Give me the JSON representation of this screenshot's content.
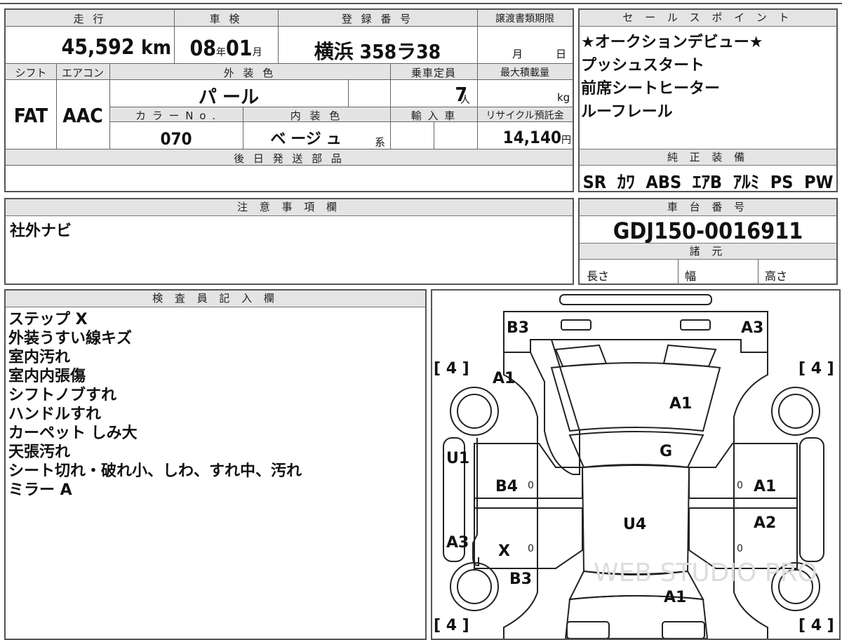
{
  "top_table": {
    "mileage_label": "走 行",
    "mileage_value": "45,592",
    "mileage_unit": "km",
    "inspection_label": "車 検",
    "inspection_year": "08",
    "inspection_year_unit": "年",
    "inspection_month": "01",
    "inspection_month_unit": "月",
    "registration_label": "登 録 番 号",
    "registration_value": "横浜 358ラ38",
    "transfer_deadline_label": "譲渡書類期限",
    "transfer_month_unit": "月",
    "transfer_day_unit": "日",
    "shift_label": "シフト",
    "shift_value": "FAT",
    "aircon_label": "エアコン",
    "aircon_value": "AAC",
    "exterior_color_label": "外 装 色",
    "exterior_color_value": "パ ール",
    "capacity_label": "乗車定員",
    "capacity_value": "7",
    "capacity_unit": "人",
    "max_load_label": "最大積載量",
    "max_load_unit": "kg",
    "color_no_label": "カ ラ ー  N o .",
    "color_no_value": "070",
    "interior_color_label": "内 装 色",
    "interior_color_value": "ベ ージ ュ",
    "interior_color_suffix": "系",
    "import_label": "輸 入 車",
    "recycle_label": "リサイクル預託金",
    "recycle_value": "14,140",
    "recycle_unit": "円",
    "later_parts_label": "後 日 発 送 部 品"
  },
  "sales_points": {
    "title": "セ ー ル ス ポ イ ン ト",
    "items": [
      "★オークションデビュー★",
      "プッシュスタート",
      "前席シートヒーター",
      "ルーフレール"
    ]
  },
  "equipment": {
    "title": "純 正 装 備",
    "value": "SR  ｶﾜ  ABS  ｴｱB  ｱﾙﾐ  PS  PW"
  },
  "notes": {
    "title": "注 意 事 項 欄",
    "value": "社外ナビ"
  },
  "chassis": {
    "title": "車 台 番 号",
    "value": "GDJ150-0016911",
    "specs_title": "諸 元",
    "length_label": "長さ",
    "width_label": "幅",
    "height_label": "高さ"
  },
  "inspector": {
    "title": "検 査 員 記 入 欄",
    "lines": [
      "ステップ X",
      "外装うすい線キズ",
      "室内汚れ",
      "室内内張傷",
      "シフトノブすれ",
      "ハンドルすれ",
      "カーペット しみ大",
      "天張汚れ",
      "シート切れ・破れ小、しわ、すれ中、汚れ",
      "ミラー A"
    ]
  },
  "diagram": {
    "tire_marks": {
      "front_left": "[ 4 ]",
      "front_right": "[ 4 ]",
      "rear_left": "[ 4 ]",
      "rear_right": "[ 4 ]"
    },
    "labels": {
      "front_left_corner": "B3",
      "front_right_corner": "A3",
      "left_front_fender": "A1",
      "hood": "A1",
      "windshield": "G",
      "left_rocker": "U1",
      "left_front_door": "B4",
      "right_front_door": "A1",
      "roof": "U4",
      "right_rear_door": "A2",
      "left_rear_quarter": "A3",
      "left_rear_door": "X",
      "left_rear_corner": "B3",
      "rear": "A1"
    },
    "zeros": [
      "0",
      "0",
      "0",
      "0"
    ],
    "watermark": "WEB STUDIO PRO"
  }
}
